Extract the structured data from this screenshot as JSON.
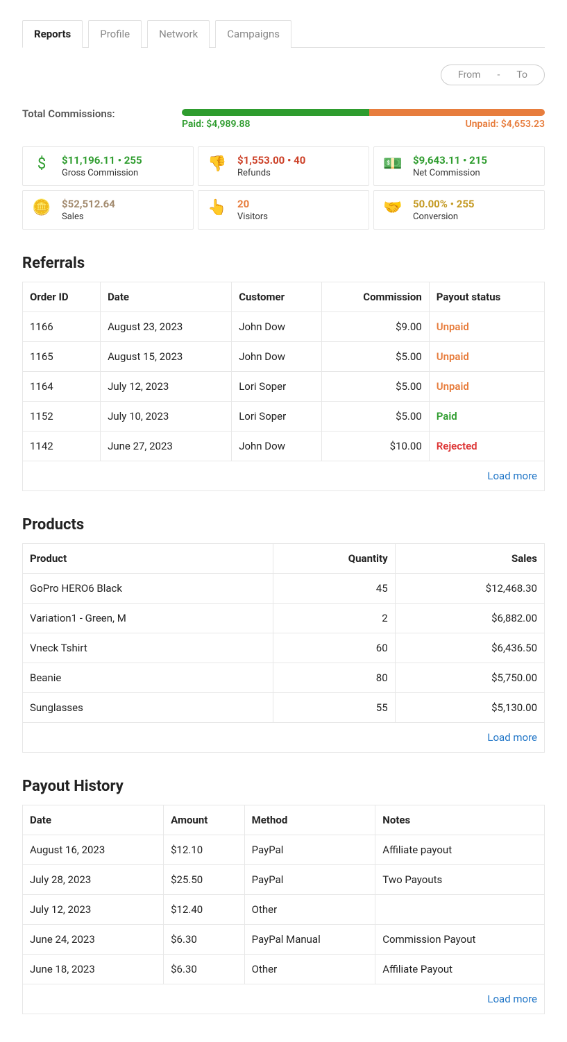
{
  "tabs": [
    "Reports",
    "Profile",
    "Network",
    "Campaigns"
  ],
  "active_tab": 0,
  "date_range": {
    "from": "From",
    "sep": "-",
    "to": "To"
  },
  "summary": {
    "total_label": "Total Commissions:",
    "paid_label": "Paid: $4,989.88",
    "unpaid_label": "Unpaid: $4,653.23",
    "paid_pct": 51.7
  },
  "stats": [
    {
      "title": "$11,196.11 • 255",
      "sub": "Gross Commission",
      "icon": "dollar-icon",
      "glyph": "$",
      "color": "c-green"
    },
    {
      "title": "$1,553.00 • 40",
      "sub": "Refunds",
      "icon": "thumbs-down-icon",
      "glyph": "👎",
      "color": "c-red"
    },
    {
      "title": "$9,643.11 • 215",
      "sub": "Net Commission",
      "icon": "hand-cash-icon",
      "glyph": "💵",
      "color": "c-green"
    },
    {
      "title": "$52,512.64",
      "sub": "Sales",
      "icon": "coins-icon",
      "glyph": "🪙",
      "color": "c-brown"
    },
    {
      "title": "20",
      "sub": "Visitors",
      "icon": "pointer-icon",
      "glyph": "👆",
      "color": "c-orange"
    },
    {
      "title": "50.00% • 255",
      "sub": "Conversion",
      "icon": "handshake-icon",
      "glyph": "🤝",
      "color": "c-gold"
    }
  ],
  "load_more_label": "Load more",
  "referrals": {
    "heading": "Referrals",
    "cols": [
      "Order ID",
      "Date",
      "Customer",
      "Commission",
      "Payout status"
    ],
    "rows": [
      {
        "order_id": "1166",
        "date": "August 23, 2023",
        "customer": "John Dow",
        "commission": "$9.00",
        "status": "Unpaid",
        "status_class": "status-unpaid"
      },
      {
        "order_id": "1165",
        "date": "August 15, 2023",
        "customer": "John Dow",
        "commission": "$5.00",
        "status": "Unpaid",
        "status_class": "status-unpaid"
      },
      {
        "order_id": "1164",
        "date": "July 12, 2023",
        "customer": "Lori Soper",
        "commission": "$5.00",
        "status": "Unpaid",
        "status_class": "status-unpaid"
      },
      {
        "order_id": "1152",
        "date": "July 10, 2023",
        "customer": "Lori Soper",
        "commission": "$5.00",
        "status": "Paid",
        "status_class": "status-paid"
      },
      {
        "order_id": "1142",
        "date": "June 27, 2023",
        "customer": "John Dow",
        "commission": "$10.00",
        "status": "Rejected",
        "status_class": "status-rejected"
      }
    ]
  },
  "products": {
    "heading": "Products",
    "cols": [
      "Product",
      "Quantity",
      "Sales"
    ],
    "rows": [
      {
        "product": "GoPro HERO6 Black",
        "qty": "45",
        "sales": "$12,468.30"
      },
      {
        "product": "Variation1 - Green, M",
        "qty": "2",
        "sales": "$6,882.00"
      },
      {
        "product": "Vneck Tshirt",
        "qty": "60",
        "sales": "$6,436.50"
      },
      {
        "product": "Beanie",
        "qty": "80",
        "sales": "$5,750.00"
      },
      {
        "product": "Sunglasses",
        "qty": "55",
        "sales": "$5,130.00"
      }
    ]
  },
  "payouts": {
    "heading": "Payout History",
    "cols": [
      "Date",
      "Amount",
      "Method",
      "Notes"
    ],
    "rows": [
      {
        "date": "August 16, 2023",
        "amount": "$12.10",
        "method": "PayPal",
        "notes": "Affiliate payout"
      },
      {
        "date": "July 28, 2023",
        "amount": "$25.50",
        "method": "PayPal",
        "notes": "Two Payouts"
      },
      {
        "date": "July 12, 2023",
        "amount": "$12.40",
        "method": "Other",
        "notes": ""
      },
      {
        "date": "June 24, 2023",
        "amount": "$6.30",
        "method": "PayPal Manual",
        "notes": "Commission Payout"
      },
      {
        "date": "June 18, 2023",
        "amount": "$6.30",
        "method": "Other",
        "notes": "Affiliate Payout"
      }
    ]
  }
}
